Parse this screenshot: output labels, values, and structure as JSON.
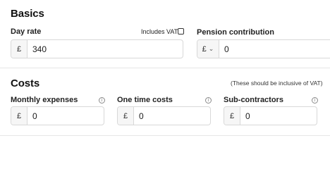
{
  "basics": {
    "heading": "Basics",
    "day_rate": {
      "label": "Day rate",
      "vat_checkbox_label": "Includes VAT",
      "vat_checked": false,
      "currency": "£",
      "value": "340"
    },
    "pension": {
      "label": "Pension contribution",
      "currency": "£",
      "value": "0"
    }
  },
  "costs": {
    "heading": "Costs",
    "note": "(These should be inclusive of VAT)",
    "monthly_expenses": {
      "label": "Monthly expenses",
      "currency": "£",
      "value": "0",
      "info": "i"
    },
    "one_time_costs": {
      "label": "One time costs",
      "currency": "£",
      "value": "0",
      "info": "i"
    },
    "sub_contractors": {
      "label": "Sub-contractors",
      "currency": "£",
      "value": "0",
      "info": "i"
    }
  }
}
